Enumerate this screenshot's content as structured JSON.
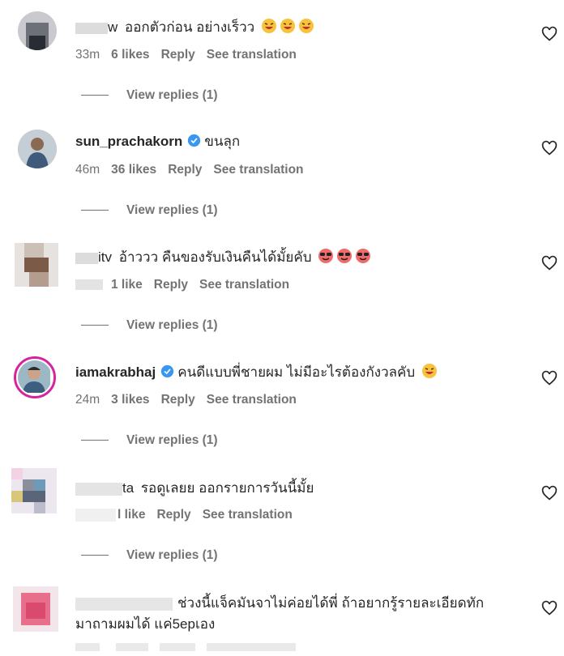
{
  "comments": [
    {
      "username": "w",
      "text": "ออกตัวก่อน อย่างเร็วว",
      "time": "33m",
      "likes": "6 likes",
      "reply": "Reply",
      "translate": "See translation",
      "view_replies": "View replies (1)"
    },
    {
      "username": "sun_prachakorn",
      "text": "ขนลุก",
      "time": "46m",
      "likes": "36 likes",
      "reply": "Reply",
      "translate": "See translation",
      "view_replies": "View replies (1)"
    },
    {
      "username": "itv",
      "text": "อ้าววว คืนของรับเงินคืนได้มั้ยคับ",
      "time": "",
      "likes": "1 like",
      "reply": "Reply",
      "translate": "See translation",
      "view_replies": "View replies (1)"
    },
    {
      "username": "iamakrabhaj",
      "text": "คนดีแบบพี่ชายผม ไม่มีอะไรต้องกังวลคับ",
      "time": "24m",
      "likes": "3 likes",
      "reply": "Reply",
      "translate": "See translation",
      "view_replies": "View replies (1)"
    },
    {
      "username": "ta",
      "text": "รอดูเลยย ออกรายการวันนี้มั้ย",
      "time": "",
      "likes": "l like",
      "reply": "Reply",
      "translate": "See translation",
      "view_replies": "View replies (1)"
    },
    {
      "username": "",
      "text_line1": "ช่วงนี้แจ็คมันจาไม่ค่อยได้พี่ ถ้าอยากรู้รายละเอียดทัก",
      "text_line2": "มาถามผมได้ แค่5epเอง"
    }
  ],
  "icons": {
    "heart": "heart-outline-icon",
    "verified": "verified-badge-icon"
  },
  "colors": {
    "verified": "#3897f0",
    "secondary_text": "#737373",
    "story_ring": "#d6249f"
  }
}
